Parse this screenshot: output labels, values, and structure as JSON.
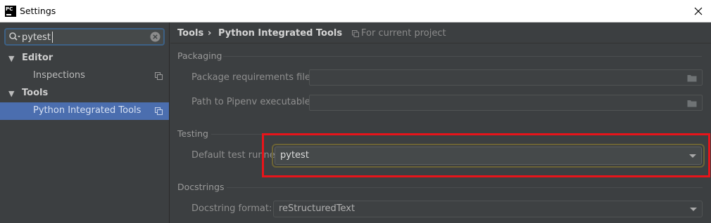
{
  "window": {
    "title": "Settings",
    "app_icon_text": "PC"
  },
  "search": {
    "value": "pytest"
  },
  "sidebar": {
    "items": [
      {
        "label": "Editor",
        "type": "group",
        "arrow": "▼"
      },
      {
        "label": "Inspections",
        "type": "leaf"
      },
      {
        "label": "Tools",
        "type": "group",
        "arrow": "▼"
      },
      {
        "label": "Python Integrated Tools",
        "type": "leaf",
        "selected": true
      }
    ]
  },
  "header": {
    "breadcrumb": [
      "Tools",
      "Python Integrated Tools"
    ],
    "separator": "›",
    "scope_label": "For current project"
  },
  "packaging": {
    "title": "Packaging",
    "requirements_label": "Package requirements file:",
    "requirements_value": "",
    "pipenv_label": "Path to Pipenv executable:",
    "pipenv_value": ""
  },
  "testing": {
    "title": "Testing",
    "runner_label": "Default test runner:",
    "runner_value": "pytest"
  },
  "docstrings": {
    "title": "Docstrings",
    "format_label": "Docstring format:",
    "format_value": "reStructuredText"
  },
  "colors": {
    "background": "#3c3f41",
    "selection": "#4b6eaf",
    "highlight": "#e8141a"
  },
  "icons": [
    "pycharm-app-icon",
    "close-icon",
    "search-icon",
    "clear-icon",
    "copy-icon",
    "project-icon",
    "folder-icon",
    "chevron-down-icon"
  ]
}
